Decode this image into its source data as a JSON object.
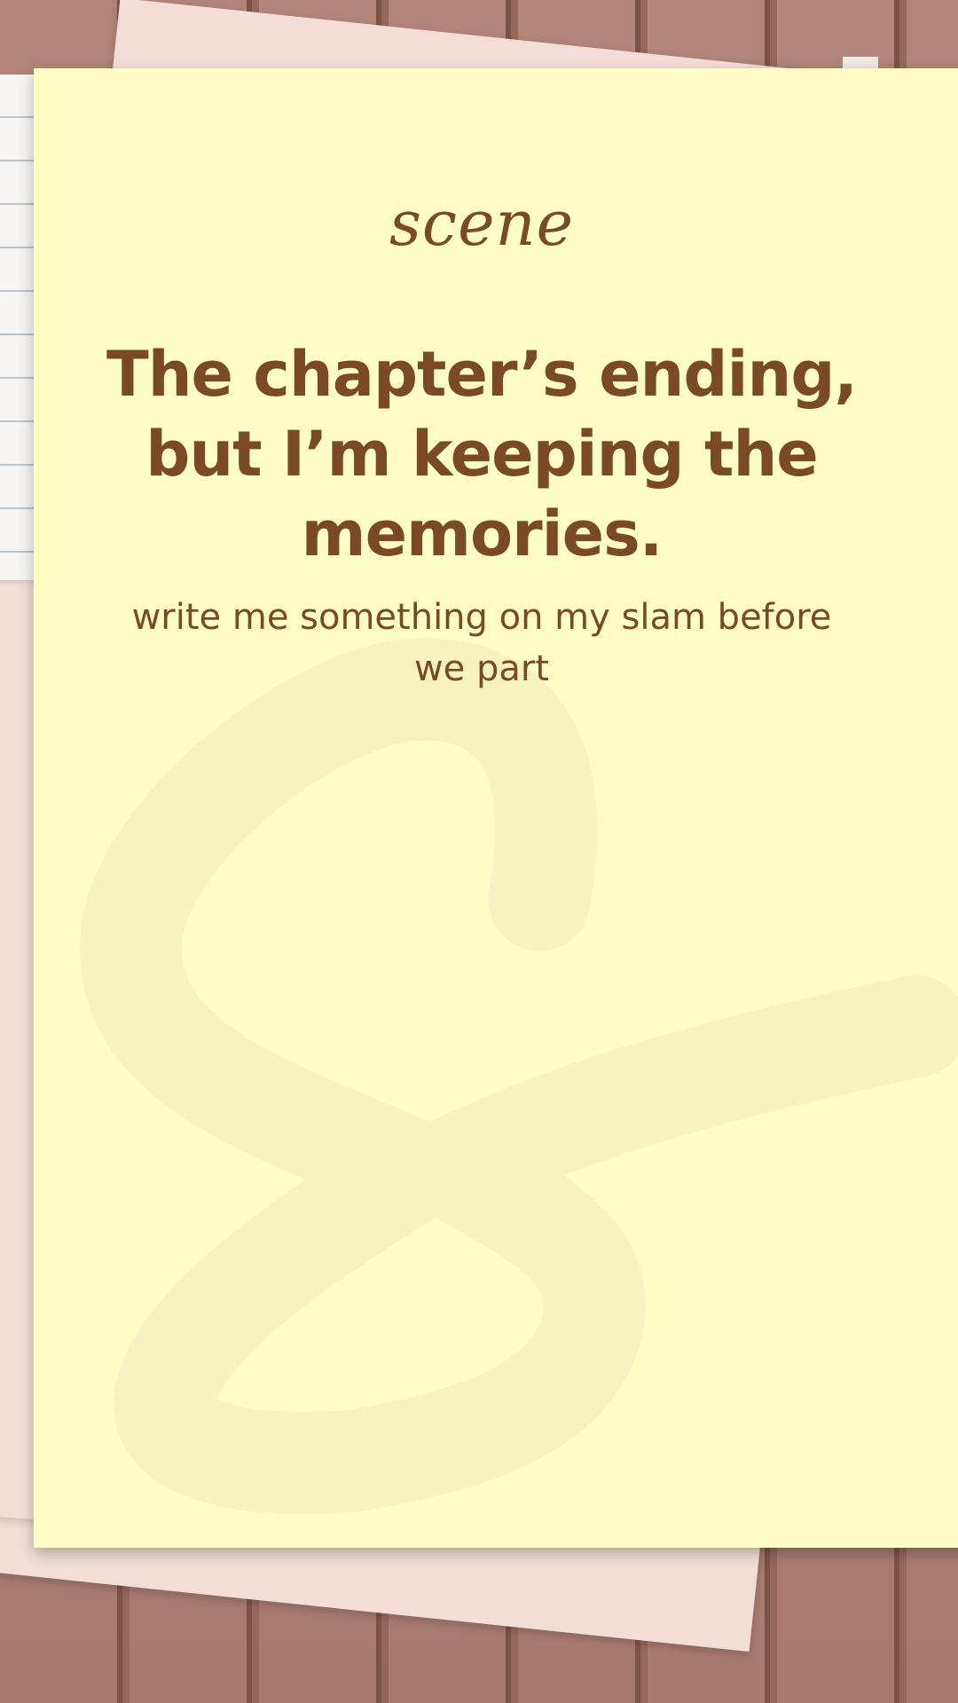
{
  "note": {
    "script_label": "scene",
    "headline": "The chapter’s ending, but I’m keeping the memories.",
    "subtext": "write me something on my slam before we part"
  },
  "colors": {
    "background_wood": "#ad8072",
    "wood_gap": "#7c5446",
    "note_yellow": "#fefdc6",
    "ampersand_tint": "#f6f3c0",
    "text_brown": "#7a4a25",
    "pink_paper": "#f4ddd6",
    "lined_paper": "#f7f5f3"
  },
  "icons": {
    "decor": "ampersand-icon"
  }
}
